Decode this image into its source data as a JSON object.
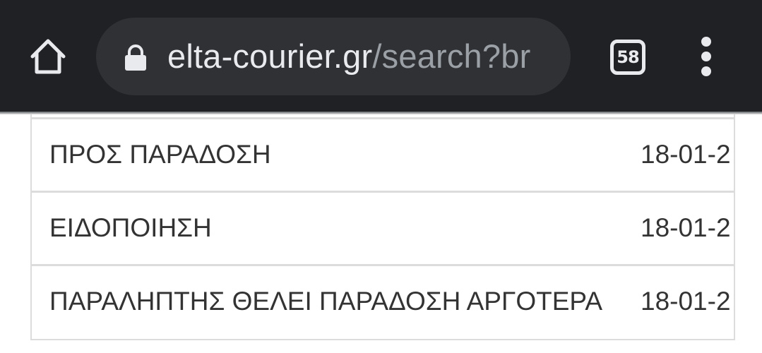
{
  "browser": {
    "url_domain": "elta-courier.gr",
    "url_path": "/search?br",
    "tab_count": "58",
    "icons": {
      "home": "home-icon",
      "lock": "lock-icon",
      "tabs": "tabs-icon",
      "menu": "more-vert-icon"
    }
  },
  "tracking": {
    "rows": [
      {
        "status": "ΠΡΟΣ ΠΑΡΑΔΟΣΗ",
        "date": "18-01-2"
      },
      {
        "status": "ΕΙΔΟΠΟΙΗΣΗ",
        "date": "18-01-2"
      },
      {
        "status": "ΠΑΡΑΛΗΠΤΗΣ ΘΕΛΕΙ ΠΑΡΑΔΟΣΗ ΑΡΓΟΤΕΡΑ",
        "date": "18-01-2"
      }
    ]
  },
  "colors": {
    "toolbar_bg": "#202124",
    "omnibox_bg": "#303134",
    "text_primary": "#333333",
    "border": "#dcdcdc"
  }
}
